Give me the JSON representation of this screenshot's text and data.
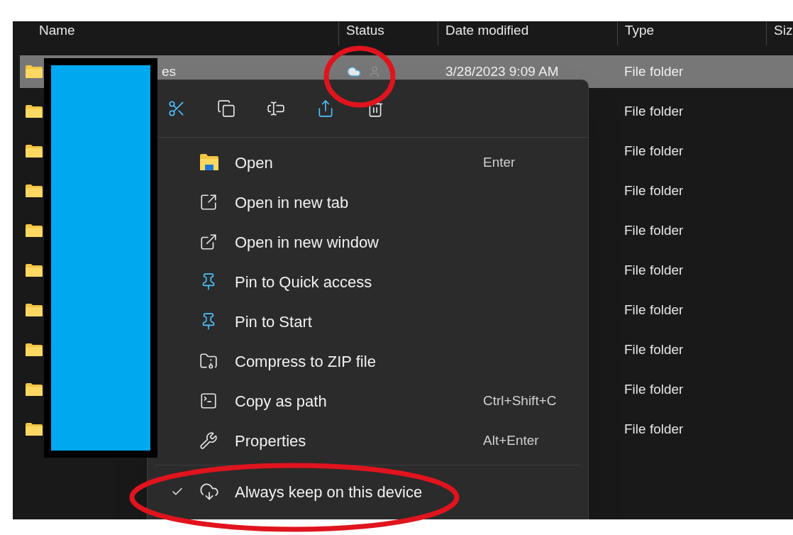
{
  "columns": [
    {
      "label": "Name"
    },
    {
      "label": "Status"
    },
    {
      "label": "Date modified"
    },
    {
      "label": "Type"
    },
    {
      "label": "Siz"
    }
  ],
  "rows": [
    {
      "name": "es",
      "date": "3/28/2023 9:09 AM",
      "type": "File folder",
      "selected": true
    },
    {
      "type": "File folder",
      "selected": false
    },
    {
      "type": "File folder",
      "selected": false
    },
    {
      "type": "File folder",
      "selected": false
    },
    {
      "type": "File folder",
      "selected": false
    },
    {
      "type": "File folder",
      "selected": false
    },
    {
      "type": "File folder",
      "selected": false
    },
    {
      "type": "File folder",
      "selected": false
    },
    {
      "type": "File folder",
      "selected": false
    },
    {
      "type": "File folder",
      "selected": false
    }
  ],
  "context_menu": {
    "items": [
      {
        "label": "Open",
        "shortcut": "Enter",
        "checked": false
      },
      {
        "label": "Open in new tab",
        "checked": false
      },
      {
        "label": "Open in new window",
        "checked": false
      },
      {
        "label": "Pin to Quick access",
        "checked": false
      },
      {
        "label": "Pin to Start",
        "checked": false
      },
      {
        "label": "Compress to ZIP file",
        "checked": false
      },
      {
        "label": "Copy as path",
        "shortcut": "Ctrl+Shift+C",
        "checked": false
      },
      {
        "label": "Properties",
        "shortcut": "Alt+Enter",
        "checked": false
      }
    ],
    "footer_items": [
      {
        "label": "Always keep on this device",
        "checked": true
      }
    ]
  }
}
